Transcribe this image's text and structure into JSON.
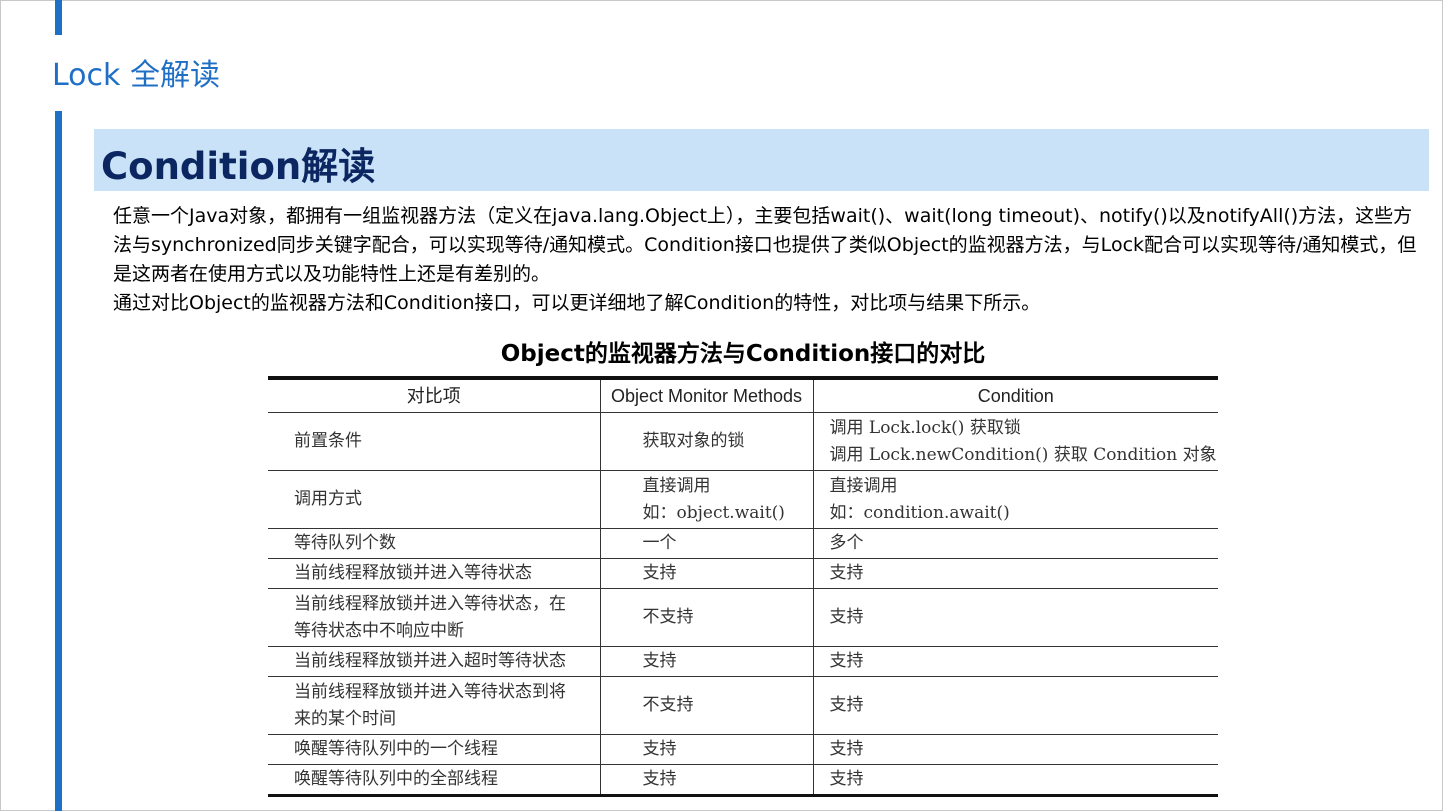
{
  "page": {
    "title": "Lock 全解读",
    "section_title": "Condition解读",
    "paragraphs": [
      "任意一个Java对象，都拥有一组监视器方法（定义在java.lang.Object上），主要包括wait()、wait(long timeout)、notify()以及notifyAll()方法，这些方法与synchronized同步关键字配合，可以实现等待/通知模式。Condition接口也提供了类似Object的监视器方法，与Lock配合可以实现等待/通知模式，但是这两者在使用方式以及功能特性上还是有差别的。",
      "通过对比Object的监视器方法和Condition接口，可以更详细地了解Condition的特性，对比项与结果下所示。"
    ],
    "accent_color": "#1f6fc5",
    "band_color": "#c9e2f8"
  },
  "table": {
    "caption": "Object的监视器方法与Condition接口的对比",
    "headers": [
      "对比项",
      "Object Monitor Methods",
      "Condition"
    ],
    "rows": [
      {
        "item": [
          "前置条件"
        ],
        "object": [
          "获取对象的锁"
        ],
        "condition": [
          "调用 Lock.lock() 获取锁",
          "调用 Lock.newCondition() 获取 Condition 对象"
        ]
      },
      {
        "item": [
          "调用方式"
        ],
        "object": [
          "直接调用",
          "如：object.wait()"
        ],
        "condition": [
          "直接调用",
          "如：condition.await()"
        ]
      },
      {
        "item": [
          "等待队列个数"
        ],
        "object": [
          "一个"
        ],
        "condition": [
          "多个"
        ]
      },
      {
        "item": [
          "当前线程释放锁并进入等待状态"
        ],
        "object": [
          "支持"
        ],
        "condition": [
          "支持"
        ]
      },
      {
        "item": [
          "当前线程释放锁并进入等待状态，在",
          "等待状态中不响应中断"
        ],
        "object": [
          "不支持"
        ],
        "condition": [
          "支持"
        ]
      },
      {
        "item": [
          "当前线程释放锁并进入超时等待状态"
        ],
        "object": [
          "支持"
        ],
        "condition": [
          "支持"
        ]
      },
      {
        "item": [
          "当前线程释放锁并进入等待状态到将",
          "来的某个时间"
        ],
        "object": [
          "不支持"
        ],
        "condition": [
          "支持"
        ]
      },
      {
        "item": [
          "唤醒等待队列中的一个线程"
        ],
        "object": [
          "支持"
        ],
        "condition": [
          "支持"
        ]
      },
      {
        "item": [
          "唤醒等待队列中的全部线程"
        ],
        "object": [
          "支持"
        ],
        "condition": [
          "支持"
        ]
      }
    ]
  }
}
